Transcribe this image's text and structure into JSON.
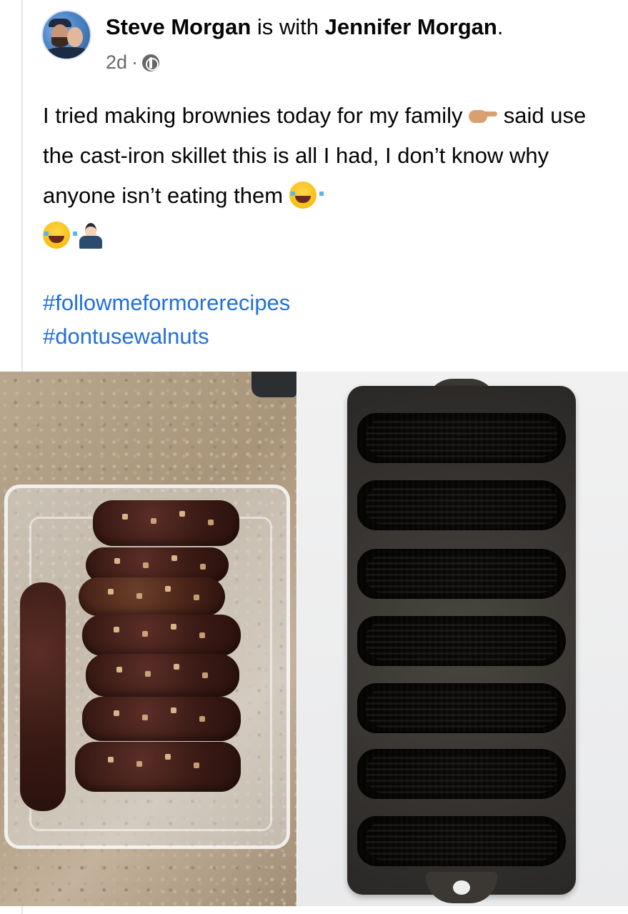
{
  "post": {
    "author": "Steve Morgan",
    "with_text": "is with",
    "tagged": "Jennifer Morgan",
    "period": ".",
    "time": "2d",
    "separator": "·",
    "privacy_icon": "globe-icon",
    "text_part1": "I tried making brownies today for my family ",
    "text_part2": " said use the cast-iron skillet this is all I had, I don’t know why anyone  isn’t eating them ",
    "emojis": [
      "point-right-emoji",
      "laughing-emoji",
      "laughing-emoji",
      "shrug-emoji"
    ],
    "hashtags": [
      "#followmeformorerecipes",
      "#dontusewalnuts"
    ]
  },
  "colors": {
    "hashtag": "#216fdb",
    "meta": "#65676b",
    "text": "#050505"
  },
  "photos": {
    "left_icon": "brownies-photo",
    "right_icon": "cornbread-pan-photo"
  }
}
